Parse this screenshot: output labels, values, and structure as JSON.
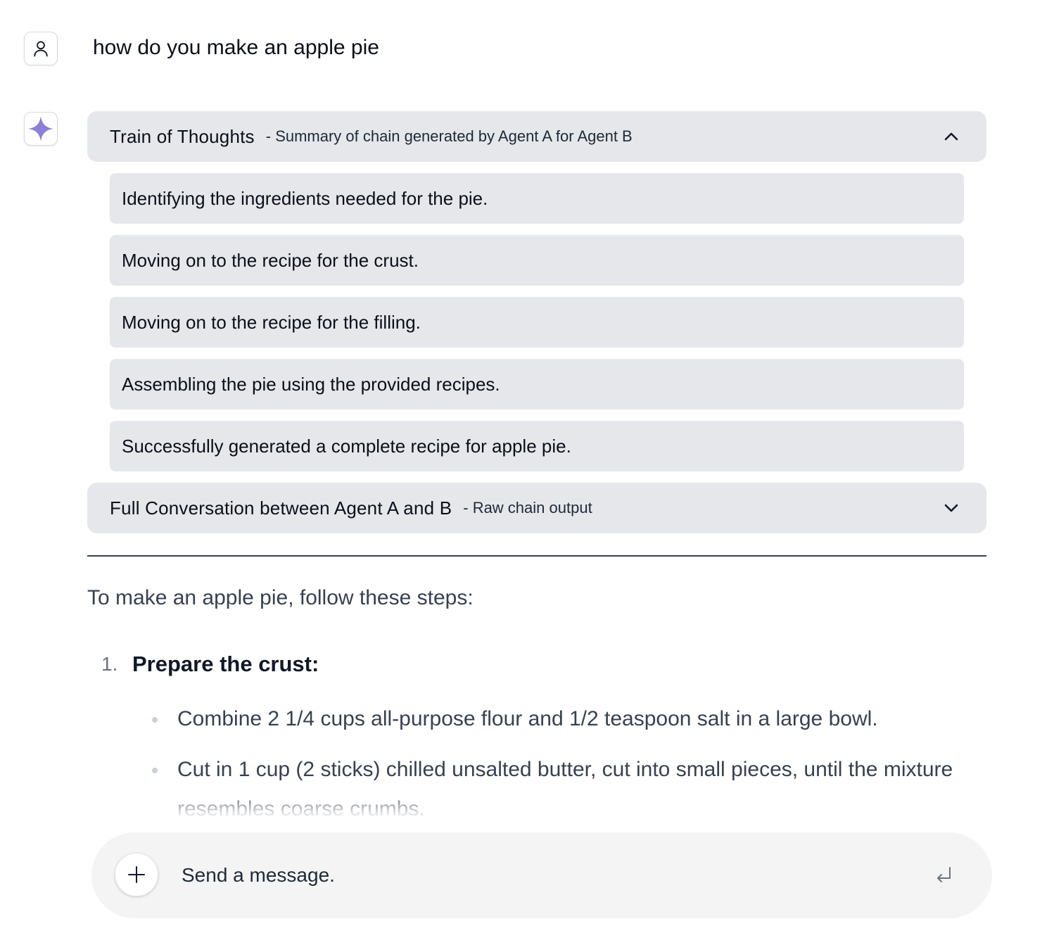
{
  "user_message": {
    "text": "how do you make an apple pie",
    "avatar_icon": "user-icon"
  },
  "assistant": {
    "avatar_icon": "sparkle-icon",
    "accent_color": "#8b7fd6",
    "train_of_thoughts": {
      "title": "Train of Thoughts",
      "subtitle": "- Summary of chain generated by Agent A for Agent B",
      "expanded": true,
      "chevron_icon": "chevron-up-icon",
      "steps": [
        "Identifying the ingredients needed for the pie.",
        "Moving on to the recipe for the crust.",
        "Moving on to the recipe for the filling.",
        "Assembling the pie using the provided recipes.",
        "Successfully generated a complete recipe for apple pie."
      ]
    },
    "full_conversation": {
      "title": "Full Conversation between Agent A and B",
      "subtitle": "- Raw chain output",
      "expanded": false,
      "chevron_icon": "chevron-down-icon"
    },
    "answer": {
      "intro": "To make an apple pie, follow these steps:",
      "list_number": "1.",
      "list_title": "Prepare the crust:",
      "bullets": [
        "Combine 2 1/4 cups all-purpose flour and 1/2 teaspoon salt in a large bowl.",
        "Cut in 1 cup (2 sticks) chilled unsalted butter, cut into small pieces, until the mixture resembles coarse crumbs."
      ]
    }
  },
  "composer": {
    "placeholder": "Send a message.",
    "attach_icon": "plus-icon",
    "send_icon": "enter-icon"
  }
}
